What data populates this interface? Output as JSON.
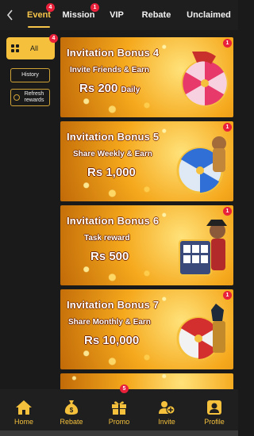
{
  "header": {
    "back_icon": "chevron-left-icon",
    "tabs": [
      {
        "label": "Event",
        "badge": "4",
        "active": true
      },
      {
        "label": "Mission",
        "badge": "1",
        "active": false
      },
      {
        "label": "VIP",
        "badge": "",
        "active": false
      },
      {
        "label": "Rebate",
        "badge": "",
        "active": false
      },
      {
        "label": "Unclaimed",
        "badge": "",
        "active": false
      }
    ]
  },
  "sidebar": {
    "all_label": "All",
    "all_badge": "4",
    "history_label": "History",
    "refresh_label": "Refresh rewards"
  },
  "cards": [
    {
      "title": "Invitation Bonus 4",
      "subtitle": "Invite Friends & Earn",
      "prize": "Rs 200",
      "period": "Daily",
      "badge": "1",
      "art": "wheel-red"
    },
    {
      "title": "Invitation Bonus 5",
      "subtitle": "Share Weekly & Earn",
      "prize": "Rs 1,000",
      "period": "",
      "badge": "1",
      "art": "wheel-blue"
    },
    {
      "title": "Invitation Bonus 6",
      "subtitle": "Task reward",
      "prize": "Rs 500",
      "period": "",
      "badge": "1",
      "art": "slot-machine"
    },
    {
      "title": "Invitation Bonus 7",
      "subtitle": "Share Monthly & Earn",
      "prize": "Rs 10,000",
      "period": "",
      "badge": "1",
      "art": "wheel-red"
    }
  ],
  "bottom_nav": [
    {
      "label": "Home",
      "icon": "home-icon",
      "badge": ""
    },
    {
      "label": "Rebate",
      "icon": "money-bag-icon",
      "badge": ""
    },
    {
      "label": "Promo",
      "icon": "gift-icon",
      "badge": "5"
    },
    {
      "label": "Invite",
      "icon": "add-user-icon",
      "badge": ""
    },
    {
      "label": "Profile",
      "icon": "profile-icon",
      "badge": ""
    }
  ],
  "colors": {
    "accent": "#f5c13c",
    "badge": "#e8203a",
    "background": "#1a1a1a"
  }
}
